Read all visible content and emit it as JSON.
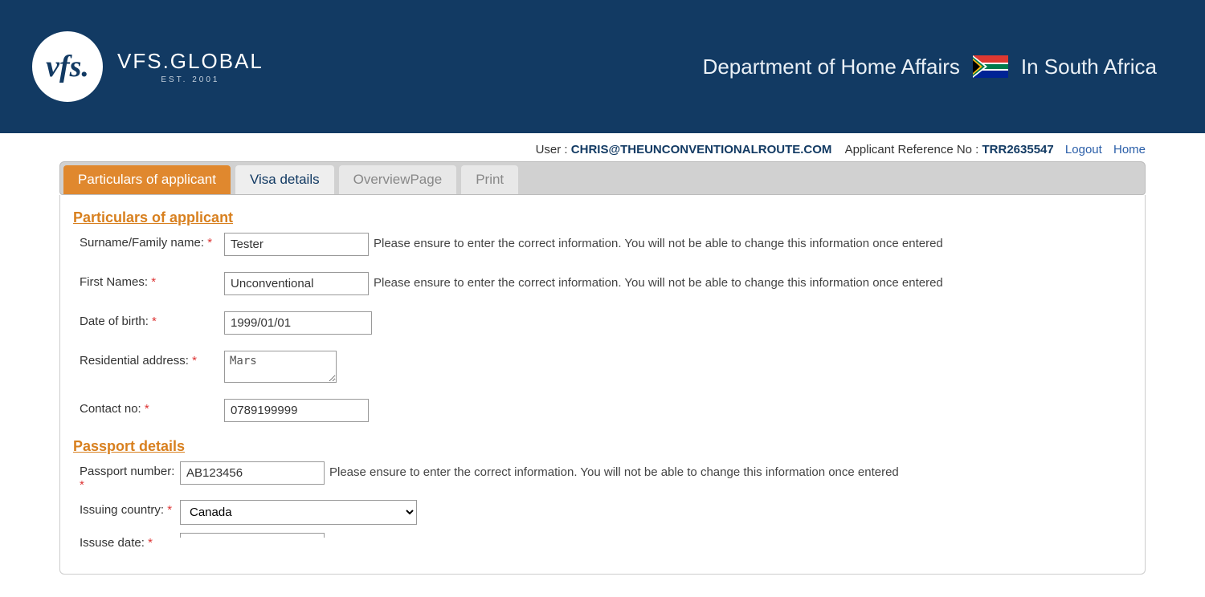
{
  "header": {
    "brand": "VFS.GLOBAL",
    "est": "EST. 2001",
    "logo_text": "vfs.",
    "department": "Department of Home Affairs",
    "country": "In South Africa"
  },
  "topbar": {
    "user_label": "User : ",
    "user_value": "CHRIS@THEUNCONVENTIONALROUTE.COM",
    "ref_label": "Applicant Reference No : ",
    "ref_value": "TRR2635547",
    "logout": "Logout",
    "home": "Home"
  },
  "tabs": {
    "particulars": "Particulars of applicant",
    "visa": "Visa details",
    "overview": "OverviewPage",
    "print": "Print"
  },
  "sections": {
    "particulars_title": "Particulars of applicant ",
    "passport_title": "Passport details "
  },
  "fields": {
    "surname": {
      "label": "Surname/Family name: ",
      "value": "Tester",
      "hint": "Please ensure to enter the correct information. You will not be able to change this information once entered"
    },
    "first_names": {
      "label": "First Names: ",
      "value": "Unconventional",
      "hint": "Please ensure to enter the correct information. You will not be able to change this information once entered"
    },
    "dob": {
      "label": "Date of birth: ",
      "value": "1999/01/01"
    },
    "address": {
      "label": "Residential address: ",
      "value": "Mars"
    },
    "contact": {
      "label": "Contact no: ",
      "value": "0789199999"
    },
    "passport_no": {
      "label": "Passport number: ",
      "value": "AB123456",
      "hint": "Please ensure to enter the correct information. You will not be able to change this information once entered"
    },
    "issuing_country": {
      "label": "Issuing country: ",
      "value": "Canada"
    },
    "issue_date": {
      "label": "Issuse date: ",
      "value": ""
    }
  },
  "required_marker": "*"
}
